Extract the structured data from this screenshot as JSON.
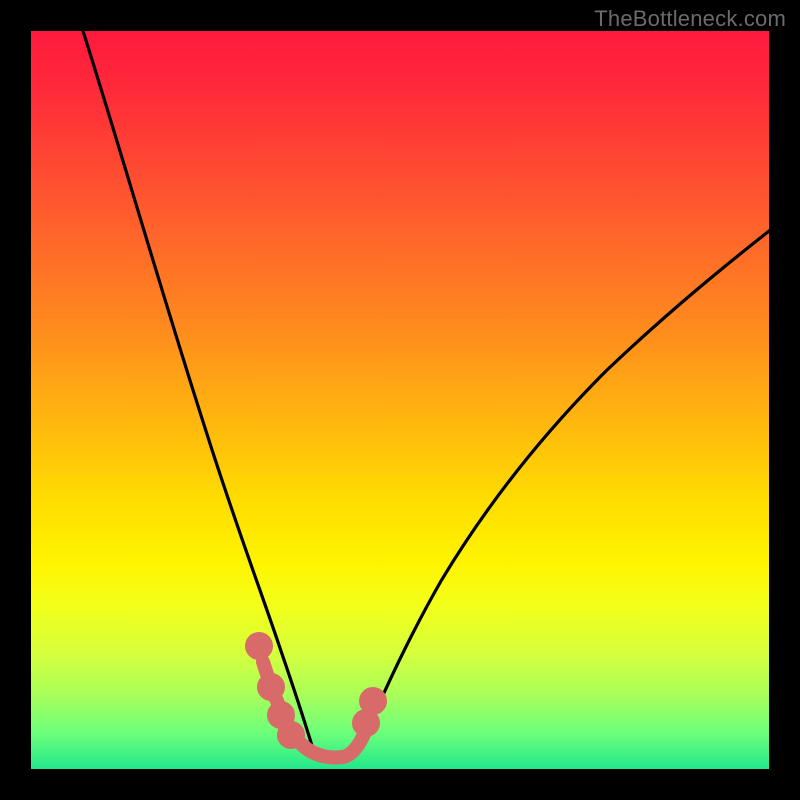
{
  "watermark": "TheBottleneck.com",
  "colors": {
    "frame": "#000000",
    "curve_left": "#000000",
    "curve_right": "#000000",
    "marker_stroke": "#d86a6a",
    "marker_fill": "#d86a6a",
    "gradient_top": "#ff1a3d",
    "gradient_bottom": "#22e88a"
  },
  "chart_data": {
    "type": "line",
    "title": "",
    "xlabel": "",
    "ylabel": "",
    "xlim": [
      0,
      100
    ],
    "ylim": [
      0,
      100
    ],
    "note": "Two steep V-shaped curves descending into a notch at the lower center; red/orange/yellow/green heat gradient indicates bottleneck severity (red=high, green=low). X-values are approximate percentages of plot width; Y-values are approximate percentages of plot height measured from top (so 100 = bottom/green).",
    "series": [
      {
        "name": "left_curve",
        "x": [
          7,
          10,
          13,
          16,
          19,
          22,
          24,
          26,
          28,
          29.5,
          31,
          32.5,
          34,
          35,
          36,
          37,
          38
        ],
        "y": [
          0,
          12,
          23,
          33,
          43,
          52,
          60,
          67,
          74,
          79,
          84,
          88,
          91.5,
          94,
          96,
          97.5,
          98.5
        ]
      },
      {
        "name": "right_curve",
        "x": [
          44,
          45,
          46.5,
          48.5,
          51,
          54,
          58,
          63,
          69,
          76,
          84,
          93,
          100
        ],
        "y": [
          98,
          96.5,
          94,
          90,
          85,
          79,
          72,
          64,
          56,
          48,
          40,
          33,
          27
        ]
      },
      {
        "name": "notch_markers",
        "x": [
          31.5,
          33,
          34.5,
          36,
          38,
          40,
          42,
          44.5,
          45.5
        ],
        "y": [
          85.5,
          90,
          93.5,
          96,
          98,
          98.5,
          98.5,
          97,
          94
        ]
      }
    ]
  }
}
